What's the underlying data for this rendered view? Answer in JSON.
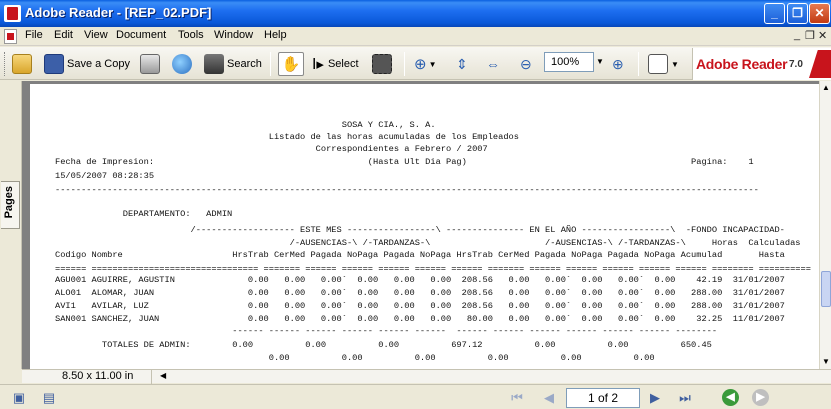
{
  "window": {
    "title": "Adobe Reader - [REP_02.PDF]"
  },
  "menu": [
    "File",
    "Edit",
    "View",
    "Document",
    "Tools",
    "Window",
    "Help"
  ],
  "toolbar": {
    "save_copy": "Save a Copy",
    "search": "Search",
    "select": "Select",
    "zoom": "100%",
    "logo": "Adobe Reader",
    "logo_version": "7.0"
  },
  "nav": {
    "pages_tab": "Pages"
  },
  "document": {
    "lines": [
      "                                                       SOSA Y CIA., S. A.",
      "                                         Listado de las horas acumuladas de los Empleados",
      "                                                  Correspondientes a Febrero / 2007",
      "Fecha de Impresion:                                         (Hasta Ult Dia Pag)                                           Pagina:    1",
      "15/05/2007 08:28:35",
      "---------------------------------------------------------------------------------------------------------------------------------------",
      "             DEPARTAMENTO:   ADMIN",
      "                          /------------------- ESTE MES -----------------\\ --------------- EN EL AÑO -----------------\\  -FONDO INCAPACIDAD-",
      "                                             /-AUSENCIAS-\\ /-TARDANZAS-\\                      /-AUSENCIAS-\\ /-TARDANZAS-\\     Horas  Calculadas",
      "Codigo Nombre                     HrsTrab CerMed Pagada NoPaga Pagada NoPaga HrsTrab CerMed Pagada NoPaga Pagada NoPaga Acumulad       Hasta",
      "====== ================================ ======= ====== ====== ====== ====== ====== ======= ====== ====== ====== ====== ====== ======== ==========",
      "AGU001 AGUIRRE, AGUSTIN              0.00   0.00   0.00`  0.00   0.00   0.00  208.56   0.00   0.00`  0.00   0.00`  0.00    42.19  31/01/2007",
      "ALO01  ALOMAR, JUAN                  0.00   0.00   0.00`  0.00   0.00   0.00  208.56   0.00   0.00`  0.00   0.00`  0.00   288.00  31/01/2007",
      "AVI1   AVILAR, LUZ                   0.00   0.00   0.00`  0.00   0.00   0.00  208.56   0.00   0.00`  0.00   0.00`  0.00   288.00  31/01/2007",
      "SAN001 SANCHEZ, JUAN                 0.00   0.00   0.00`  0.00   0.00   0.00   80.00   0.00   0.00`  0.00   0.00`  0.00    32.25  11/01/2007",
      "                                  ------ ------ ------ ------ ------ ------  ------ ------ ------ ------ ------ ------ --------",
      "         TOTALES DE ADMIN:        0.00          0.00          0.00          697.12          0.00          0.00          650.45",
      "                                         0.00          0.00          0.00          0.00          0.00          0.00"
    ]
  },
  "status": {
    "page_size": "8.50 x 11.00 in",
    "page_indicator": "1 of 2"
  },
  "colors": {
    "title_bar": "#0a58d8",
    "doc_background": "#808080",
    "adobe_red": "#c8141c"
  }
}
